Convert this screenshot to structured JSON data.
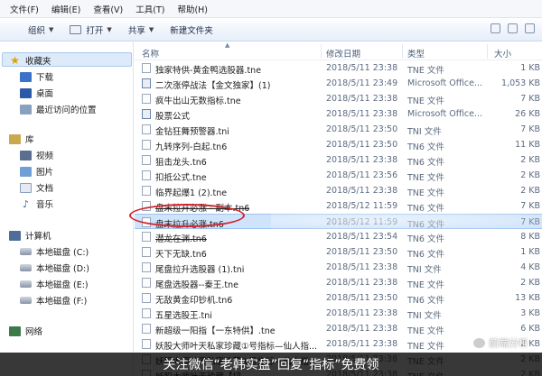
{
  "menubar": {
    "items": [
      "文件(F)",
      "编辑(E)",
      "查看(V)",
      "工具(T)",
      "帮助(H)"
    ]
  },
  "toolbar": {
    "organize": "组织",
    "open": "打开",
    "share": "共享",
    "new_folder": "新建文件夹"
  },
  "columns": {
    "name": "名称",
    "date": "修改日期",
    "type": "类型",
    "size": "大小"
  },
  "navpane": {
    "favorites": "收藏夹",
    "downloads": "下载",
    "desktop": "桌面",
    "recent": "最近访问的位置",
    "libraries": "库",
    "videos": "视频",
    "pictures": "图片",
    "documents": "文档",
    "music": "音乐",
    "computer": "计算机",
    "drive_c": "本地磁盘 (C:)",
    "drive_d": "本地磁盘 (D:)",
    "drive_e": "本地磁盘 (E:)",
    "drive_f": "本地磁盘 (F:)",
    "network": "网络"
  },
  "files": [
    {
      "name": "独家特供-黄金鸭选股器.tne",
      "date": "2018/5/11 23:38",
      "type": "TNE 文件",
      "size": "1 KB",
      "icon": "file-icon"
    },
    {
      "name": "二次涨停战法【金文独家】(1)",
      "date": "2018/5/11 23:49",
      "type": "Microsoft Office...",
      "size": "1,053 KB",
      "icon": "doc-icon"
    },
    {
      "name": "疯牛出山无数指标.tne",
      "date": "2018/5/11 23:38",
      "type": "TNE 文件",
      "size": "7 KB",
      "icon": "file-icon"
    },
    {
      "name": "股票公式",
      "date": "2018/5/11 23:38",
      "type": "Microsoft Office...",
      "size": "26 KB",
      "icon": "doc-icon"
    },
    {
      "name": "金钻狂舞预警器.tni",
      "date": "2018/5/11 23:50",
      "type": "TNI 文件",
      "size": "7 KB",
      "icon": "file-icon"
    },
    {
      "name": "九转序列-白起.tn6",
      "date": "2018/5/11 23:50",
      "type": "TN6 文件",
      "size": "11 KB",
      "icon": "file-icon"
    },
    {
      "name": "狙击龙头.tn6",
      "date": "2018/5/11 23:38",
      "type": "TN6 文件",
      "size": "2 KB",
      "icon": "file-icon"
    },
    {
      "name": "扣抵公式.tne",
      "date": "2018/5/11 23:56",
      "type": "TNE 文件",
      "size": "2 KB",
      "icon": "file-icon"
    },
    {
      "name": "临界起爆1 (2).tne",
      "date": "2018/5/11 23:38",
      "type": "TNE 文件",
      "size": "2 KB",
      "icon": "file-icon"
    },
    {
      "name": "盘末拉升必涨 - 副本.tn6",
      "date": "2018/5/12 11:59",
      "type": "TN6 文件",
      "size": "7 KB",
      "icon": "file-icon",
      "strike": true
    },
    {
      "name": "盘末拉升必涨.tn6",
      "date": "2018/5/12 11:59",
      "type": "TN6 文件",
      "size": "7 KB",
      "icon": "file-icon",
      "selected": true
    },
    {
      "name": "潜龙在渊.tn6",
      "date": "2018/5/11 23:54",
      "type": "TN6 文件",
      "size": "8 KB",
      "icon": "file-icon",
      "strike": true
    },
    {
      "name": "天下无缺.tn6",
      "date": "2018/5/11 23:50",
      "type": "TN6 文件",
      "size": "1 KB",
      "icon": "file-icon"
    },
    {
      "name": "尾盘拉升选股器 (1).tni",
      "date": "2018/5/11 23:38",
      "type": "TNI 文件",
      "size": "4 KB",
      "icon": "file-icon"
    },
    {
      "name": "尾盘选股器--秦王.tne",
      "date": "2018/5/11 23:38",
      "type": "TNE 文件",
      "size": "2 KB",
      "icon": "file-icon"
    },
    {
      "name": "无敌黄金印钞机.tn6",
      "date": "2018/5/11 23:50",
      "type": "TN6 文件",
      "size": "13 KB",
      "icon": "file-icon"
    },
    {
      "name": "五星选股王.tni",
      "date": "2018/5/11 23:38",
      "type": "TNI 文件",
      "size": "3 KB",
      "icon": "file-icon"
    },
    {
      "name": "新超级一阳指【一东特供】.tne",
      "date": "2018/5/11 23:38",
      "type": "TNE 文件",
      "size": "6 KB",
      "icon": "file-icon"
    },
    {
      "name": "妖股大师叶天私家珍藏①号指标—仙人指...",
      "date": "2018/5/11 23:38",
      "type": "TNE 文件",
      "size": "2 KB",
      "icon": "file-icon"
    },
    {
      "name": "妖股大师叶天私家珍藏①号指标—仙人指...",
      "date": "2018/5/11 23:38",
      "type": "TNE 文件",
      "size": "2 KB",
      "icon": "file-icon"
    },
    {
      "name": "妖股大师叶天珍藏【扭...",
      "date": "2018/5/11 23:38",
      "type": "TNE 文件",
      "size": "2 KB",
      "icon": "file-icon"
    }
  ],
  "banner": {
    "text": "关注微信“老韩实盘”回复“指标”免费领"
  },
  "watermark": {
    "text": "前端分析"
  },
  "colors": {
    "annotation_red": "#d0242c",
    "selection_blue": "#cfe3fa"
  }
}
